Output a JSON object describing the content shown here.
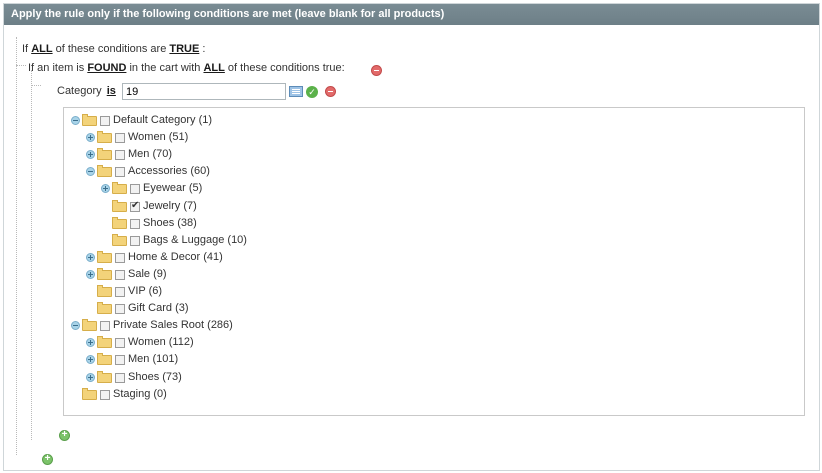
{
  "header": {
    "title": "Apply the rule only if the following conditions are met (leave blank for all products)"
  },
  "combine": {
    "prefix": "If",
    "aggregator": "ALL",
    "middle": "of these conditions are",
    "value": "TRUE",
    "suffix": ":"
  },
  "found": {
    "prefix": "If an item is",
    "found": "FOUND",
    "middle": "in the cart with",
    "aggregator": "ALL",
    "suffix": "of these conditions true:"
  },
  "category": {
    "label": "Category",
    "operator": "is",
    "value": "19"
  },
  "tree": [
    {
      "label": "Default Category (1)",
      "expander": "minus",
      "checked": false
    },
    {
      "label": "Women (51)",
      "expander": "plus",
      "checked": false
    },
    {
      "label": "Men (70)",
      "expander": "plus",
      "checked": false
    },
    {
      "label": "Accessories (60)",
      "expander": "minus",
      "checked": false
    },
    {
      "label": "Eyewear (5)",
      "expander": "plus",
      "checked": false
    },
    {
      "label": "Jewelry (7)",
      "expander": "none",
      "checked": true
    },
    {
      "label": "Shoes (38)",
      "expander": "none",
      "checked": false
    },
    {
      "label": "Bags & Luggage (10)",
      "expander": "none",
      "checked": false
    },
    {
      "label": "Home & Decor (41)",
      "expander": "plus",
      "checked": false
    },
    {
      "label": "Sale (9)",
      "expander": "plus",
      "checked": false
    },
    {
      "label": "VIP (6)",
      "expander": "none",
      "checked": false
    },
    {
      "label": "Gift Card (3)",
      "expander": "none",
      "checked": false
    },
    {
      "label": "Private Sales Root (286)",
      "expander": "minus",
      "checked": false
    },
    {
      "label": "Women (112)",
      "expander": "plus",
      "checked": false
    },
    {
      "label": "Men (101)",
      "expander": "plus",
      "checked": false
    },
    {
      "label": "Shoes (73)",
      "expander": "plus",
      "checked": false
    },
    {
      "label": "Staging (0)",
      "expander": "none",
      "checked": false
    }
  ],
  "icons": {
    "remove": "remove-condition-icon",
    "add": "add-condition-icon",
    "chooser": "chooser-icon",
    "apply": "apply-checkmark-icon"
  },
  "colors": {
    "header_bg": "#6d7f87",
    "folder": "#f3d37a",
    "add_green": "#7cc36a",
    "remove_red": "#e26a6a"
  }
}
